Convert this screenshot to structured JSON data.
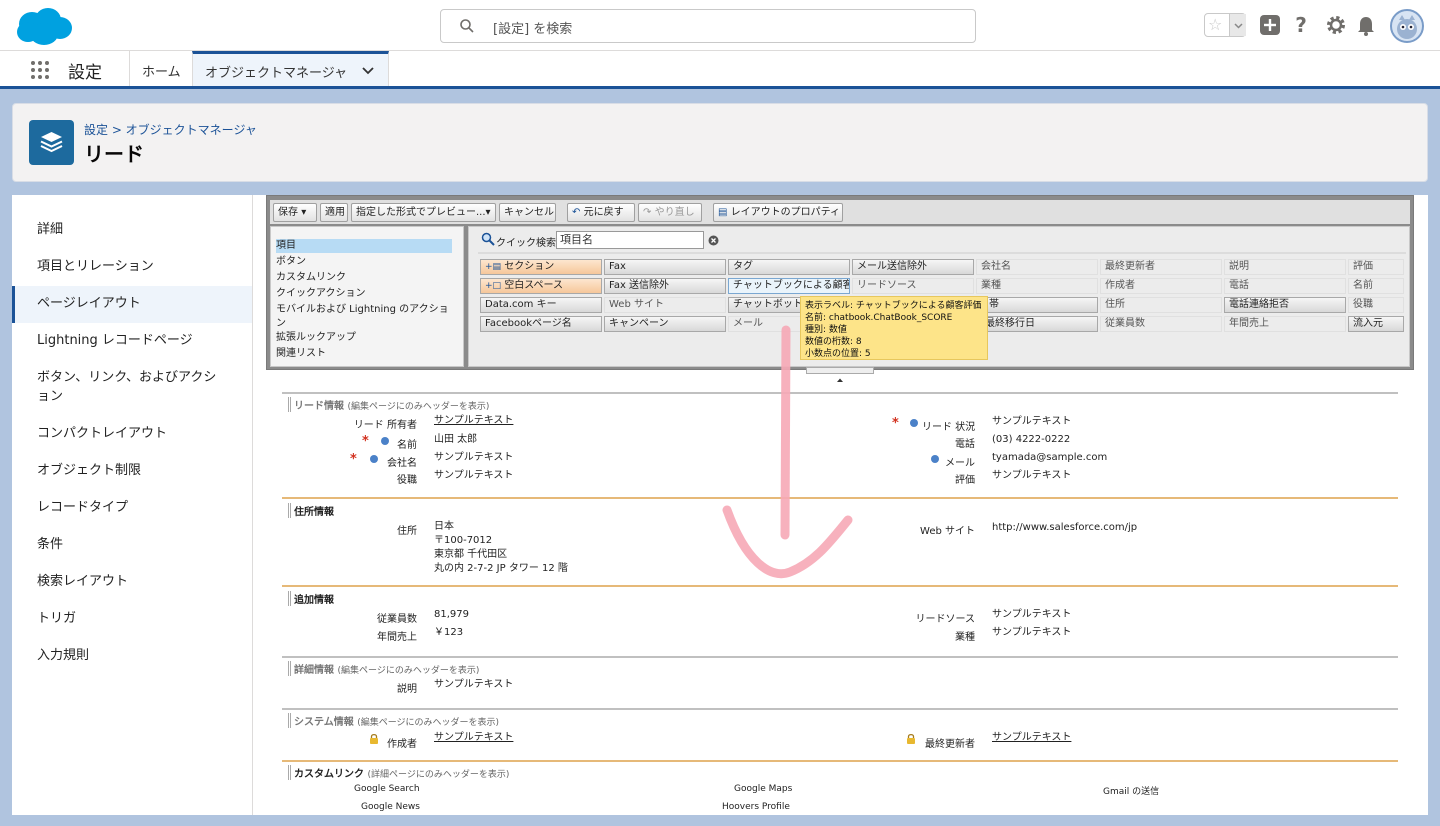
{
  "header": {
    "search_placeholder": "[設定] を検索",
    "brand_color": "#00a1e0"
  },
  "nav": {
    "app_title": "設定",
    "tabs": [
      {
        "label": "ホーム"
      },
      {
        "label": "オブジェクトマネージャ"
      }
    ]
  },
  "page": {
    "breadcrumb": "設定 > オブジェクトマネージャ",
    "title": "リード"
  },
  "sidebar": {
    "items": [
      {
        "label": "詳細"
      },
      {
        "label": "項目とリレーション"
      },
      {
        "label": "ページレイアウト"
      },
      {
        "label": "Lightning レコードページ"
      },
      {
        "label": "ボタン、リンク、およびアクション"
      },
      {
        "label": "コンパクトレイアウト"
      },
      {
        "label": "オブジェクト制限"
      },
      {
        "label": "レコードタイプ"
      },
      {
        "label": "条件"
      },
      {
        "label": "検索レイアウト"
      },
      {
        "label": "トリガ"
      },
      {
        "label": "入力規則"
      }
    ]
  },
  "toolbar": {
    "save": "保存",
    "apply": "適用",
    "preview": "指定した形式でプレビュー...",
    "cancel": "キャンセル",
    "undo": "元に戻す",
    "redo": "やり直し",
    "properties": "レイアウトのプロパティ"
  },
  "palette": {
    "categories": [
      "項目",
      "ボタン",
      "カスタムリンク",
      "クイックアクション",
      "モバイルおよび Lightning のアクション",
      "拡張ルックアップ",
      "関連リスト"
    ],
    "quick_search_label": "クイック検索",
    "quick_search_value": "項目名",
    "fields": [
      [
        "セクション",
        "Fax",
        "タグ",
        "メール送信除外",
        "会社名",
        "最終更新者",
        "説明",
        "評価"
      ],
      [
        "空白スペース",
        "Fax 送信除外",
        "チャットブックによる顧客評価",
        "リードソース",
        "業種",
        "作成者",
        "電話",
        "名前"
      ],
      [
        "Data.com キー",
        "Web サイト",
        "チャットボット名",
        "帯",
        "住所",
        "電話連絡拒否",
        "役職"
      ],
      [
        "Facebookページ名",
        "キャンペーン",
        "メール",
        "最終移行日",
        "従業員数",
        "年間売上",
        "流入元"
      ]
    ],
    "tooltip": [
      "表示ラベル: チャットブックによる顧客評価",
      "名前: chatbook.ChatBook_SCORE",
      "種別: 数値",
      "数値の桁数: 8",
      "小数点の位置: 5"
    ]
  },
  "layout": {
    "header_note": "(編集ページにのみヘッダーを表示)",
    "detail_note": "(詳細ページにのみヘッダーを表示)",
    "lead_info": {
      "title": "リード情報",
      "owner_label": "リード 所有者",
      "owner_value": "サンプルテキスト",
      "name_label": "名前",
      "name_value": "山田 太郎",
      "company_label": "会社名",
      "company_value": "サンプルテキスト",
      "role_label": "役職",
      "role_value": "サンプルテキスト",
      "status_label": "リード 状況",
      "status_value": "サンプルテキスト",
      "phone_label": "電話",
      "phone_value": "(03) 4222-0222",
      "email_label": "メール",
      "email_value": "tyamada@sample.com",
      "rating_label": "評価",
      "rating_value": "サンプルテキスト"
    },
    "address": {
      "title": "住所情報",
      "addr_label": "住所",
      "addr_lines": [
        "日本",
        "〒100-7012",
        "東京都 千代田区",
        "丸の内 2-7-2 JP タワー 12 階"
      ],
      "web_label": "Web サイト",
      "web_value": "http://www.salesforce.com/jp"
    },
    "additional": {
      "title": "追加情報",
      "emp_label": "従業員数",
      "emp_value": "81,979",
      "rev_label": "年間売上",
      "rev_value": "￥123",
      "source_label": "リードソース",
      "source_value": "サンプルテキスト",
      "industry_label": "業種",
      "industry_value": "サンプルテキスト"
    },
    "detail": {
      "title": "詳細情報",
      "desc_label": "説明",
      "desc_value": "サンプルテキスト"
    },
    "system": {
      "title": "システム情報",
      "created_label": "作成者",
      "created_value": "サンプルテキスト",
      "modified_label": "最終更新者",
      "modified_value": "サンプルテキスト"
    },
    "custom_links": {
      "title": "カスタムリンク",
      "links": [
        "Google Search",
        "Google Maps",
        "Gmail の送信",
        "Google News",
        "Hoovers Profile"
      ]
    }
  }
}
